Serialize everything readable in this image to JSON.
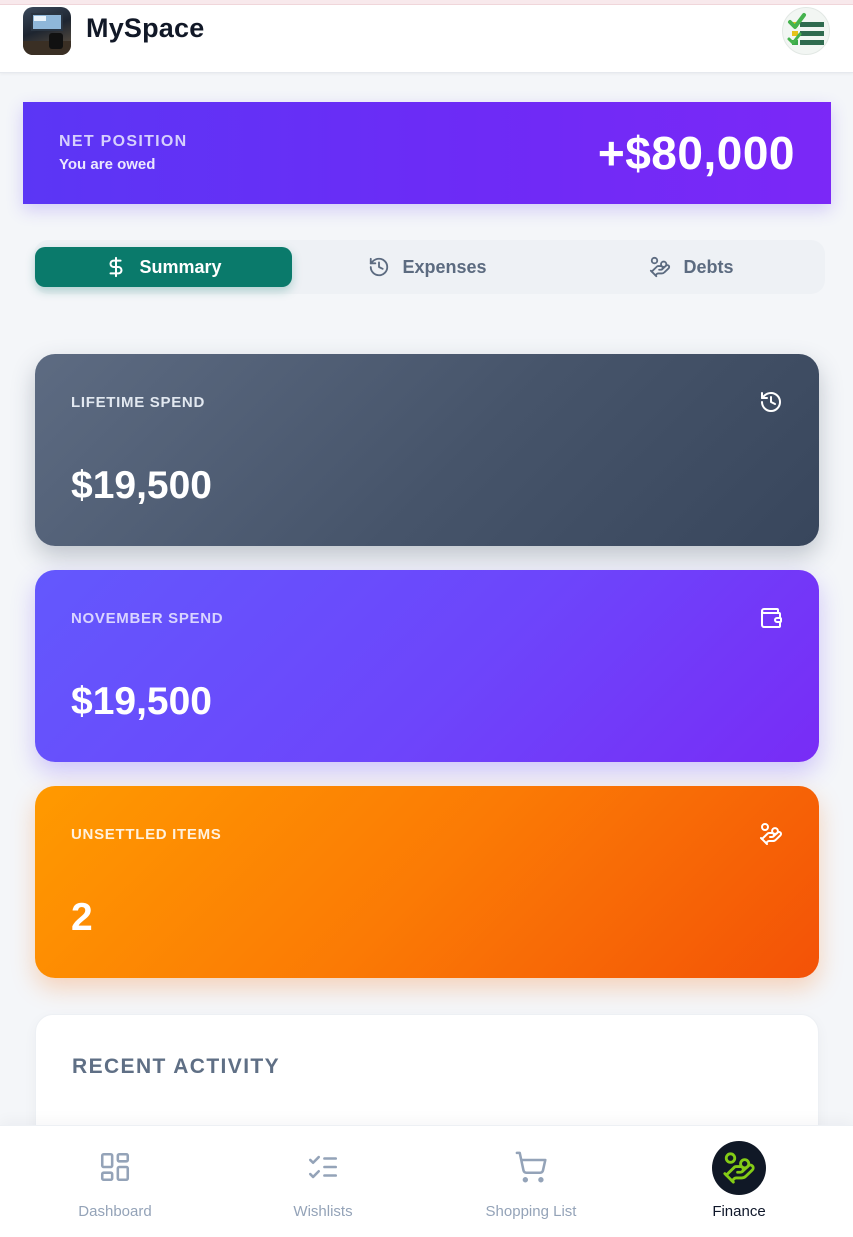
{
  "header": {
    "app_name": "MySpace",
    "logo_icon": "workspace-logo-icon",
    "profile_icon": "checklist-avatar-icon"
  },
  "net_position": {
    "label": "NET POSITION",
    "subtitle": "You are owed",
    "value": "+$80,000"
  },
  "tabs": [
    {
      "label": "Summary",
      "icon": "dollar-icon",
      "active": true
    },
    {
      "label": "Expenses",
      "icon": "history-icon",
      "active": false
    },
    {
      "label": "Debts",
      "icon": "hand-coins-icon",
      "active": false
    }
  ],
  "cards": [
    {
      "label": "LIFETIME SPEND",
      "value": "$19,500",
      "icon": "history-icon"
    },
    {
      "label": "NOVEMBER SPEND",
      "value": "$19,500",
      "icon": "wallet-icon"
    },
    {
      "label": "UNSETTLED ITEMS",
      "value": "2",
      "icon": "hand-coins-icon"
    }
  ],
  "recent_activity": {
    "title": "RECENT ACTIVITY"
  },
  "bottom_nav": [
    {
      "label": "Dashboard",
      "icon": "dashboard-icon",
      "active": false
    },
    {
      "label": "Wishlists",
      "icon": "checklist-icon",
      "active": false
    },
    {
      "label": "Shopping List",
      "icon": "cart-icon",
      "active": false
    },
    {
      "label": "Finance",
      "icon": "hand-coins-icon",
      "active": true
    }
  ],
  "colors": {
    "accent_teal": "#0a7a6b",
    "net_purple": "#6d2bf6",
    "lifetime_slate": "#46546a",
    "november_violet": "#6d45fb",
    "unsettled_orange": "#fb7a05",
    "finance_active_green": "#84cc16"
  }
}
